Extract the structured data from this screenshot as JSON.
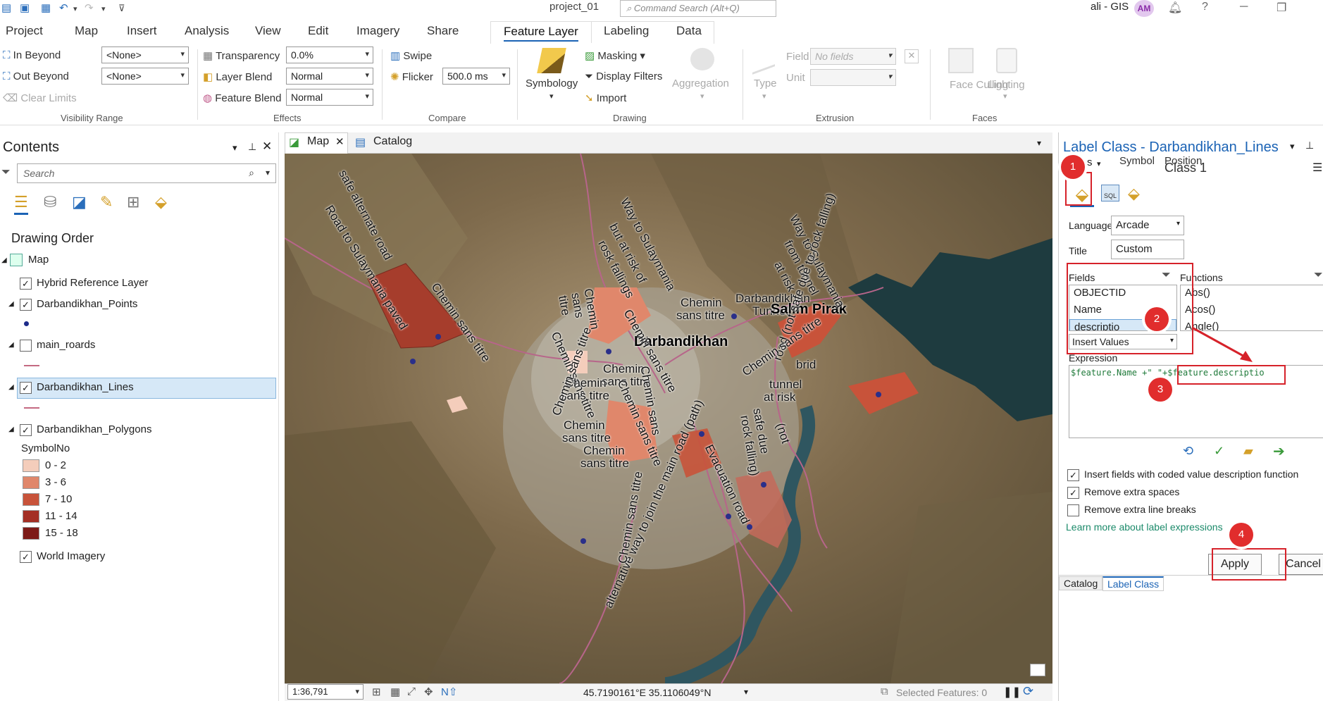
{
  "app": {
    "title": "project_01",
    "command_search": "Command Search (Alt+Q)",
    "user": "ali - GIS",
    "avatar": "AM"
  },
  "ribbon_tabs": [
    "Project",
    "Map",
    "Insert",
    "Analysis",
    "View",
    "Edit",
    "Imagery",
    "Share",
    "Feature Layer",
    "Labeling",
    "Data"
  ],
  "active_tab": "Feature Layer",
  "ribbon": {
    "in_beyond": "In Beyond",
    "out_beyond": "Out Beyond",
    "clear_limits": "Clear Limits",
    "in_beyond_value": "<None>",
    "out_beyond_value": "<None>",
    "visibility_group": "Visibility Range",
    "transparency": "Transparency",
    "transparency_value": "0.0%",
    "layer_blend": "Layer Blend",
    "layer_blend_value": "Normal",
    "feature_blend": "Feature Blend",
    "feature_blend_value": "Normal",
    "effects_group": "Effects",
    "swipe": "Swipe",
    "flicker": "Flicker",
    "flicker_value": "500.0",
    "flicker_unit": "ms",
    "compare_group": "Compare",
    "symbology": "Symbology",
    "masking": "Masking",
    "display_filters": "Display Filters",
    "import": "Import",
    "aggregation": "Aggregation",
    "drawing_group": "Drawing",
    "type": "Type",
    "field": "Field",
    "field_value": "No fields",
    "unit": "Unit",
    "extrusion_group": "Extrusion",
    "face_culling": "Face Culling",
    "lighting": "Lighting",
    "faces_group": "Faces"
  },
  "contents": {
    "title": "Contents",
    "search_placeholder": "Search",
    "drawing_order": "Drawing Order",
    "map": "Map",
    "hybrid": "Hybrid Reference Layer",
    "points": "Darbandikhan_Points",
    "roads": "main_roards",
    "lines": "Darbandikhan_Lines",
    "polygons": "Darbandikhan_Polygons",
    "symbolno": "SymbolNo",
    "classes": [
      {
        "label": "0 - 2",
        "color": "#f4cdbb"
      },
      {
        "label": "3 - 6",
        "color": "#e0876b"
      },
      {
        "label": "7 - 10",
        "color": "#c8533a"
      },
      {
        "label": "11 - 14",
        "color": "#a42f24"
      },
      {
        "label": "15 - 18",
        "color": "#7d1a17"
      }
    ],
    "imagery": "World Imagery"
  },
  "map_view": {
    "tab_map": "Map",
    "tab_catalog": "Catalog",
    "scale": "1:36,791",
    "coords": "45.7190161°E 35.1106049°N",
    "selected": "Selected Features: 0",
    "labels": {
      "road_sulaymania": "Road to Sulaymania paved",
      "safe_alt": "safe alternate road",
      "way_sulay": "Way to Sulaymania",
      "risk_rock": "but at risk of",
      "rock_fall": "rosk fallings",
      "chemin": "Chemin sans titre",
      "chemin1": "Chemin",
      "sans_titre": "sans titre",
      "darbandikhan": "Darbandikhan",
      "darbandikhan2": "Darbandikhan",
      "tunnel": "Tunnel",
      "salim": "Salim Pirak",
      "way_sulay2": "Way to Sulaymania",
      "from_tunnel": "from tunnel",
      "at_risk": "at risk",
      "road_not_safe": "road (not safe due to rock falling)",
      "tunnel2": "tunnel",
      "at_risk2": "at risk",
      "evacuation": "Evacuation road",
      "alternative": "alternative way to join the main road (path)",
      "safe_due": "safe due",
      "rock_falling": "rock falling)",
      "not": "(not",
      "chemin_b": "Chemin",
      "sans_b": "sans",
      "titre_b": "titre",
      "chemin_c": "Chemin sans titre",
      "chemin_d": "Chemin sans titre",
      "chemin_e": "Chemin sans titre",
      "chemin_f": "Chemin",
      "sans_f": "sans titre",
      "chemin_g": "Chemin sans titre",
      "chemin_h": "Chemin sans titre",
      "chemin_i": "Chemin sans",
      "titre_i": "titre",
      "brid": "brid"
    }
  },
  "label_class": {
    "title": "Label Class - Darbandikhan_Lines",
    "class": "Class 1",
    "tab_class": "s",
    "tab_symbol": "Symbol",
    "tab_position": "Position",
    "language_label": "Language",
    "language": "Arcade",
    "title_label": "Title",
    "title_value": "Custom",
    "fields_label": "Fields",
    "functions_label": "Functions",
    "fields": [
      "OBJECTID",
      "Name",
      "descriptio"
    ],
    "functions": [
      "Abs()",
      "Acos()",
      "Angle()"
    ],
    "insert_values": "Insert Values",
    "expression_label": "Expression",
    "expression_a": "$feature.Name +\"_\"+",
    "expression_b": "$feature.descriptio",
    "opt1": "Insert fields with coded value description function",
    "opt2": "Remove extra spaces",
    "opt3": "Remove extra line breaks",
    "learn_more": "Learn more about label expressions",
    "apply": "Apply",
    "cancel": "Cancel",
    "steps": [
      "1",
      "2",
      "3",
      "4"
    ]
  },
  "bottom_tabs": {
    "catalog": "Catalog",
    "label_class": "Label Class"
  }
}
